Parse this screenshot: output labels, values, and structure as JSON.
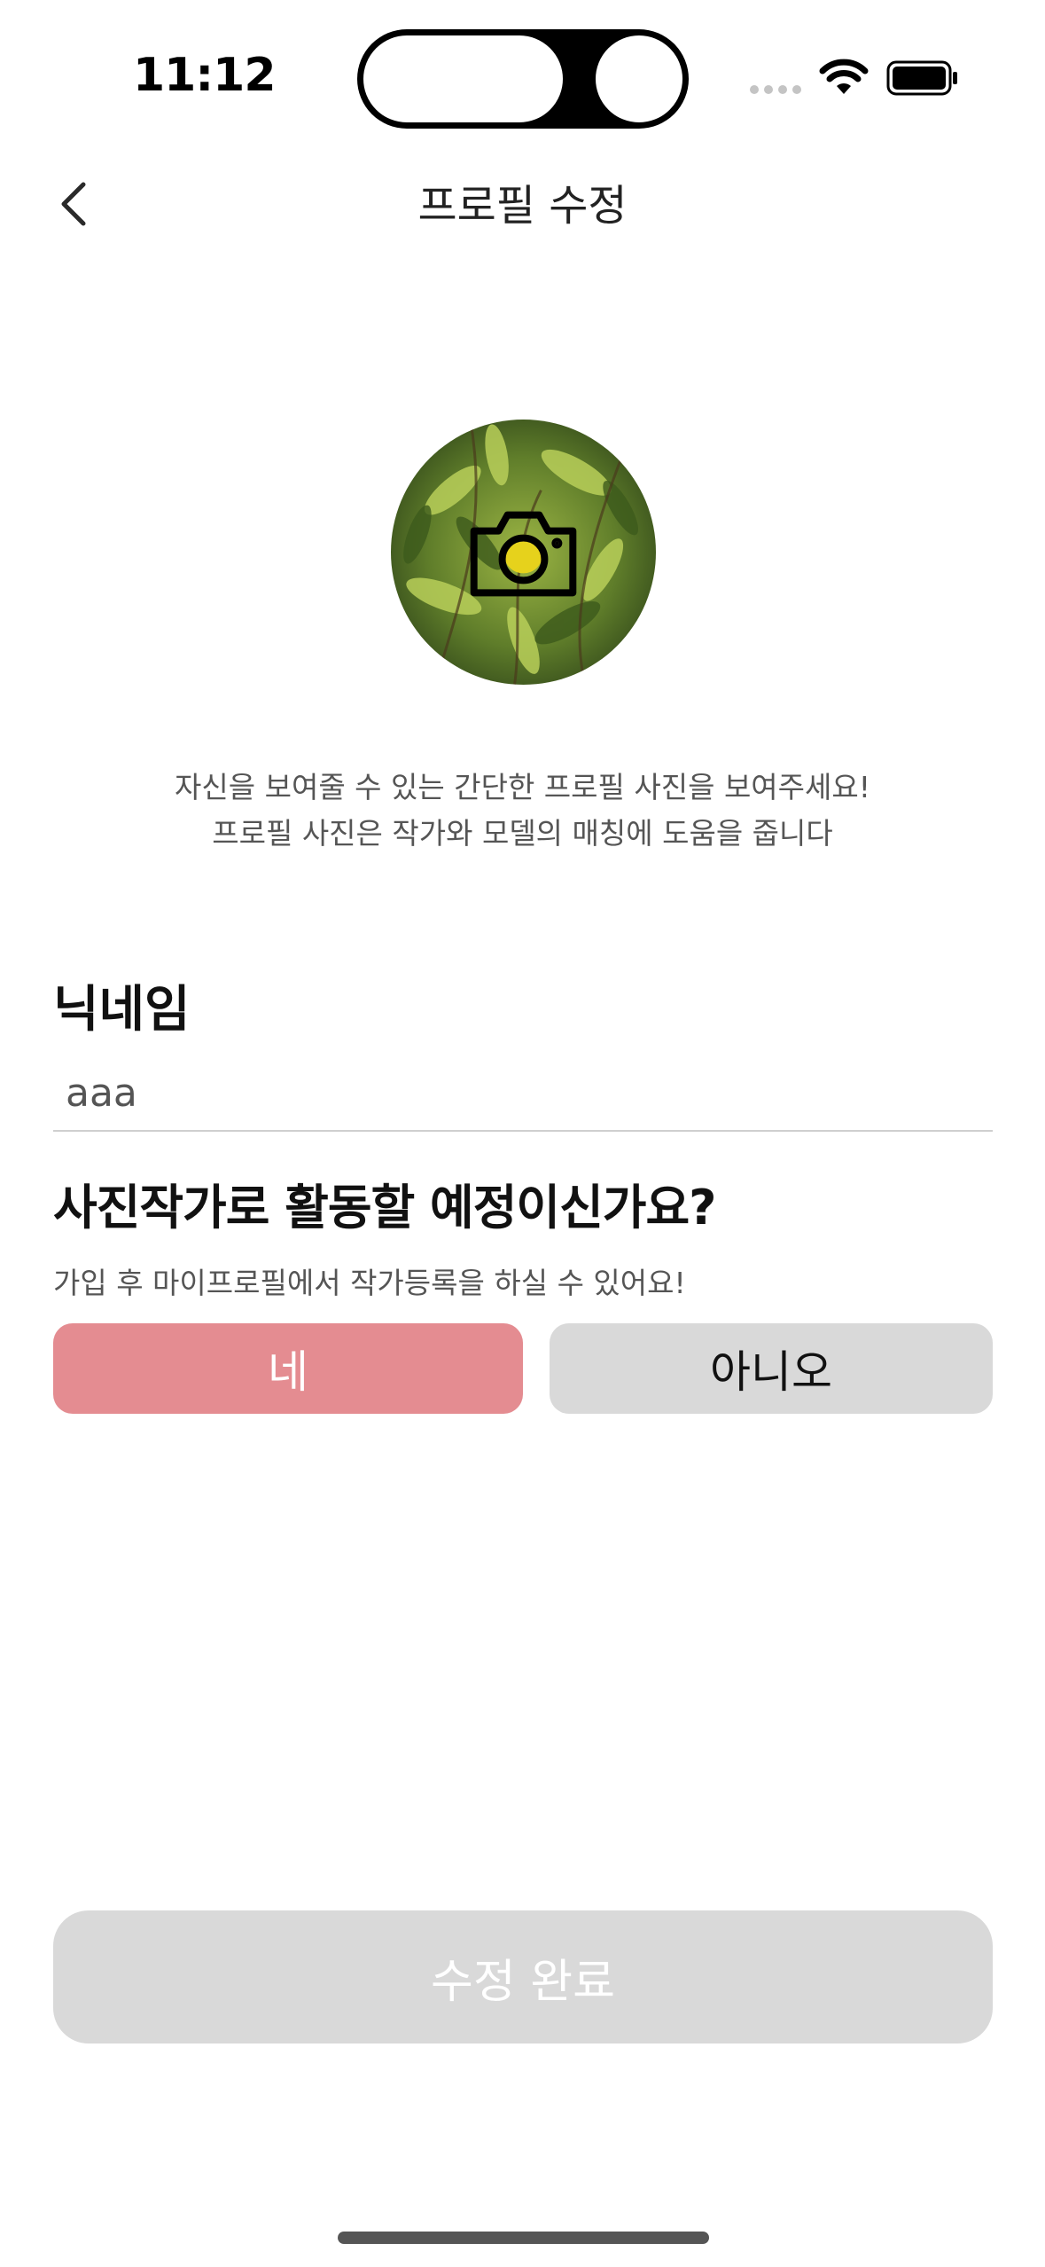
{
  "status_bar": {
    "time": "11:12"
  },
  "header": {
    "title": "프로필 수정",
    "back_icon": "chevron-left-icon"
  },
  "avatar": {
    "icon": "camera-icon"
  },
  "description": {
    "line1": "자신을 보여줄 수 있는 간단한 프로필 사진을 보여주세요!",
    "line2": "프로필 사진은 작가와 모델의 매칭에 도움을 줍니다"
  },
  "nickname": {
    "label": "닉네임",
    "value": "aaa"
  },
  "photographer": {
    "question": "사진작가로 활동할 예정이신가요?",
    "sub": "가입 후 마이프로필에서 작가등록을 하실 수 있어요!",
    "yes_label": "네",
    "no_label": "아니오",
    "selected": "네"
  },
  "submit": {
    "label": "수정 완료"
  },
  "colors": {
    "accent": "#e48c91",
    "inactive": "#d9d9d9",
    "text_primary": "#111111",
    "text_secondary": "#555555"
  }
}
